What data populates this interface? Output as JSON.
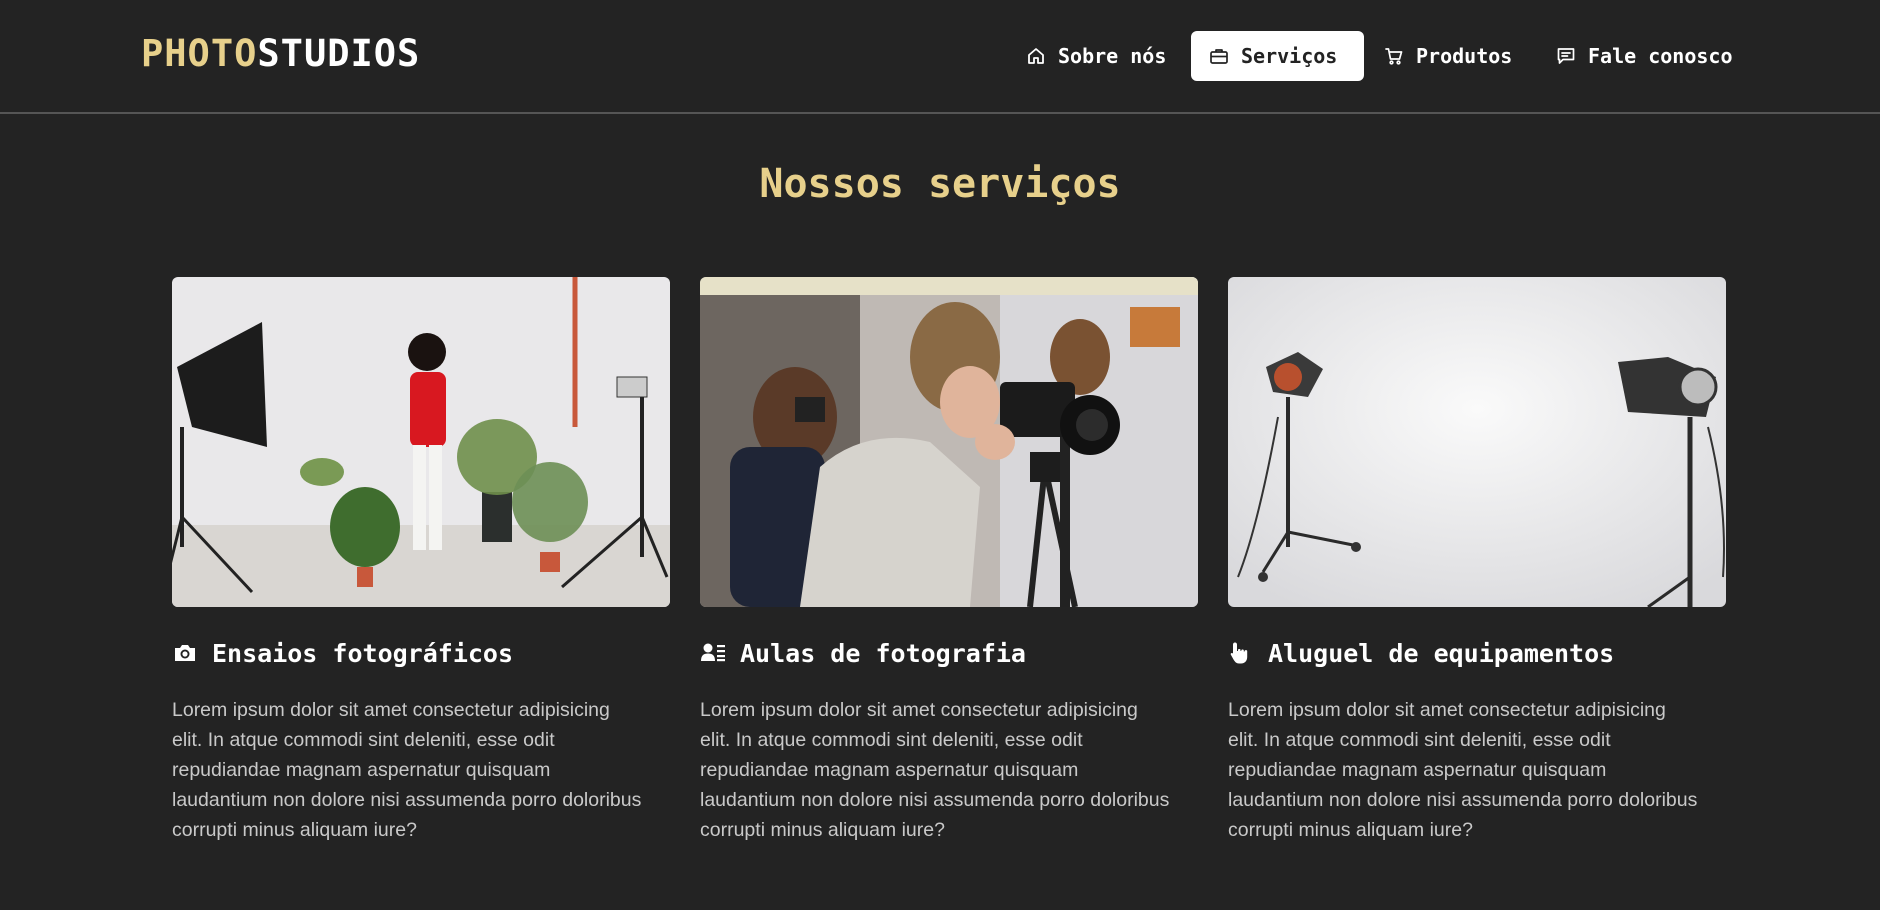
{
  "brand": {
    "part1": "PHOTO",
    "part2": "STUDIOS",
    "accent_color": "#e7d08b"
  },
  "nav": {
    "items": [
      {
        "label": "Sobre nós",
        "icon": "home-icon",
        "active": false
      },
      {
        "label": "Serviços",
        "icon": "briefcase-icon",
        "active": true
      },
      {
        "label": "Produtos",
        "icon": "cart-icon",
        "active": false
      },
      {
        "label": "Fale conosco",
        "icon": "chat-icon",
        "active": false
      }
    ]
  },
  "services": {
    "title": "Nossos serviços",
    "cards": [
      {
        "heading": "Ensaios fotográficos",
        "icon": "camera-icon",
        "text": "Lorem ipsum dolor sit amet consectetur adipisicing elit. In atque commodi sint deleniti, esse odit repudiandae magnam aspernatur quisquam laudantium non dolore nisi assumenda porro doloribus corrupti minus aliquam iure?"
      },
      {
        "heading": "Aulas de fotografia",
        "icon": "user-list-icon",
        "text": "Lorem ipsum dolor sit amet consectetur adipisicing elit. In atque commodi sint deleniti, esse odit repudiandae magnam aspernatur quisquam laudantium non dolore nisi assumenda porro doloribus corrupti minus aliquam iure?"
      },
      {
        "heading": "Aluguel de equipamentos",
        "icon": "pointer-hand-icon",
        "text": "Lorem ipsum dolor sit amet consectetur adipisicing elit. In atque commodi sint deleniti, esse odit repudiandae magnam aspernatur quisquam laudantium non dolore nisi assumenda porro doloribus corrupti minus aliquam iure?"
      }
    ]
  }
}
